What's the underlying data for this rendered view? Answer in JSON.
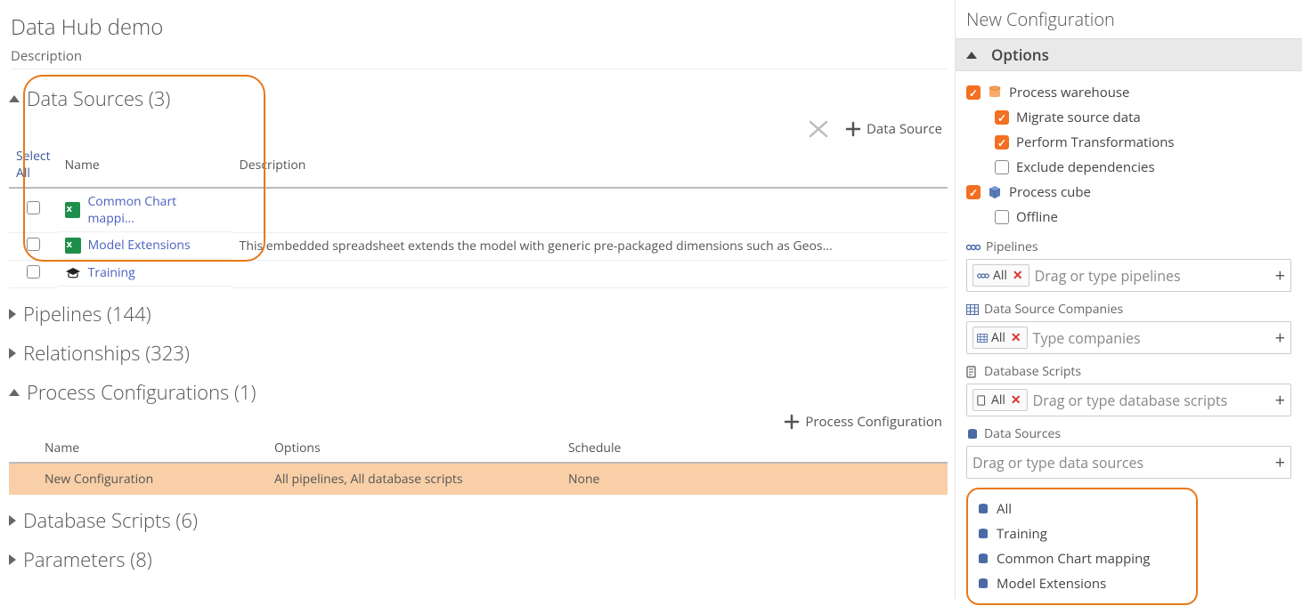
{
  "page": {
    "title": "Data Hub demo",
    "subtitle": "Description"
  },
  "sections": {
    "dataSources": {
      "label": "Data Sources (3)",
      "open": true
    },
    "pipelines": {
      "label": "Pipelines (144)",
      "open": false
    },
    "relationships": {
      "label": "Relationships (323)",
      "open": false
    },
    "processCfg": {
      "label": "Process Configurations (1)",
      "open": true
    },
    "dbScripts": {
      "label": "Database Scripts (6)",
      "open": false
    },
    "parameters": {
      "label": "Parameters (8)",
      "open": false
    }
  },
  "dsToolbar": {
    "delete": "",
    "add": "Data Source"
  },
  "dsTable": {
    "headers": {
      "selectAll": "Select All",
      "name": "Name",
      "desc": "Description"
    },
    "rows": [
      {
        "name": "Common Chart mappi...",
        "desc": "",
        "icon": "excel"
      },
      {
        "name": "Model Extensions",
        "desc": "This embedded spreadsheet extends the model with generic pre-packaged dimensions such as Geos...",
        "icon": "excel"
      },
      {
        "name": "Training",
        "desc": "",
        "icon": "grad"
      }
    ]
  },
  "pcToolbar": {
    "add": "Process Configuration"
  },
  "pcTable": {
    "headers": {
      "name": "Name",
      "options": "Options",
      "schedule": "Schedule"
    },
    "rows": [
      {
        "name": "New Configuration",
        "options": "All pipelines, All database scripts",
        "schedule": "None"
      }
    ]
  },
  "right": {
    "title": "New Configuration",
    "optionsHdr": "Options",
    "opts": {
      "warehouse": "Process warehouse",
      "migrate": "Migrate source data",
      "transforms": "Perform Transformations",
      "exclude": "Exclude dependencies",
      "cube": "Process cube",
      "offline": "Offline"
    },
    "pipelines": {
      "hdr": "Pipelines",
      "chip": "All",
      "ph": "Drag or type pipelines"
    },
    "dscomp": {
      "hdr": "Data Source Companies",
      "chip": "All",
      "ph": "Type companies"
    },
    "dbscripts": {
      "hdr": "Database Scripts",
      "chip": "All",
      "ph": "Drag or type database scripts"
    },
    "datasources": {
      "hdr": "Data Sources",
      "ph": "Drag or type data sources"
    },
    "dsDropdown": [
      "All",
      "Training",
      "Common Chart mapping",
      "Model Extensions"
    ]
  }
}
